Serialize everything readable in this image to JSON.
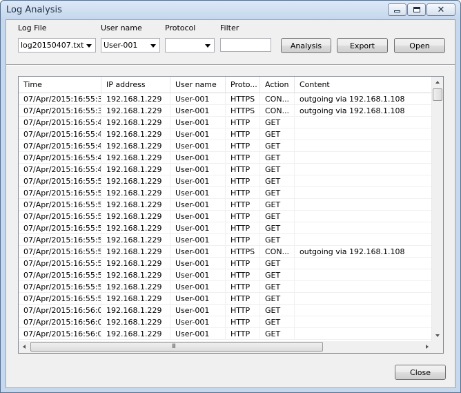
{
  "window": {
    "title": "Log Analysis"
  },
  "toolbar": {
    "log_file_label": "Log File",
    "log_file_value": "log20150407.txt",
    "username_label": "User name",
    "username_value": "User-001",
    "protocol_label": "Protocol",
    "protocol_value": "",
    "filter_label": "Filter",
    "filter_value": "",
    "analysis_label": "Analysis",
    "export_label": "Export",
    "open_label": "Open"
  },
  "table": {
    "columns": [
      "Time",
      "IP address",
      "User name",
      "Proto...",
      "Action",
      "Content"
    ],
    "rows": [
      [
        "07/Apr/2015:16:55:3...",
        "192.168.1.229",
        "User-001",
        "HTTPS",
        "CON...",
        "outgoing via 192.168.1.108"
      ],
      [
        "07/Apr/2015:16:55:3...",
        "192.168.1.229",
        "User-001",
        "HTTPS",
        "CON...",
        "outgoing via 192.168.1.108"
      ],
      [
        "07/Apr/2015:16:55:4...",
        "192.168.1.229",
        "User-001",
        "HTTP",
        "GET",
        ""
      ],
      [
        "07/Apr/2015:16:55:4...",
        "192.168.1.229",
        "User-001",
        "HTTP",
        "GET",
        ""
      ],
      [
        "07/Apr/2015:16:55:4...",
        "192.168.1.229",
        "User-001",
        "HTTP",
        "GET",
        ""
      ],
      [
        "07/Apr/2015:16:55:4...",
        "192.168.1.229",
        "User-001",
        "HTTP",
        "GET",
        ""
      ],
      [
        "07/Apr/2015:16:55:4...",
        "192.168.1.229",
        "User-001",
        "HTTP",
        "GET",
        ""
      ],
      [
        "07/Apr/2015:16:55:5...",
        "192.168.1.229",
        "User-001",
        "HTTP",
        "GET",
        ""
      ],
      [
        "07/Apr/2015:16:55:5...",
        "192.168.1.229",
        "User-001",
        "HTTP",
        "GET",
        ""
      ],
      [
        "07/Apr/2015:16:55:5...",
        "192.168.1.229",
        "User-001",
        "HTTP",
        "GET",
        ""
      ],
      [
        "07/Apr/2015:16:55:5...",
        "192.168.1.229",
        "User-001",
        "HTTP",
        "GET",
        ""
      ],
      [
        "07/Apr/2015:16:55:5...",
        "192.168.1.229",
        "User-001",
        "HTTP",
        "GET",
        ""
      ],
      [
        "07/Apr/2015:16:55:5...",
        "192.168.1.229",
        "User-001",
        "HTTP",
        "GET",
        ""
      ],
      [
        "07/Apr/2015:16:55:5...",
        "192.168.1.229",
        "User-001",
        "HTTPS",
        "CON...",
        "outgoing via 192.168.1.108"
      ],
      [
        "07/Apr/2015:16:55:5...",
        "192.168.1.229",
        "User-001",
        "HTTP",
        "GET",
        ""
      ],
      [
        "07/Apr/2015:16:55:5...",
        "192.168.1.229",
        "User-001",
        "HTTP",
        "GET",
        ""
      ],
      [
        "07/Apr/2015:16:55:5...",
        "192.168.1.229",
        "User-001",
        "HTTP",
        "GET",
        ""
      ],
      [
        "07/Apr/2015:16:55:5...",
        "192.168.1.229",
        "User-001",
        "HTTP",
        "GET",
        ""
      ],
      [
        "07/Apr/2015:16:56:0...",
        "192.168.1.229",
        "User-001",
        "HTTP",
        "GET",
        ""
      ],
      [
        "07/Apr/2015:16:56:0...",
        "192.168.1.229",
        "User-001",
        "HTTP",
        "GET",
        ""
      ],
      [
        "07/Apr/2015:16:56:0...",
        "192.168.1.229",
        "User-001",
        "HTTP",
        "GET",
        ""
      ]
    ],
    "hscroll_grip": "III"
  },
  "footer": {
    "close_label": "Close"
  }
}
